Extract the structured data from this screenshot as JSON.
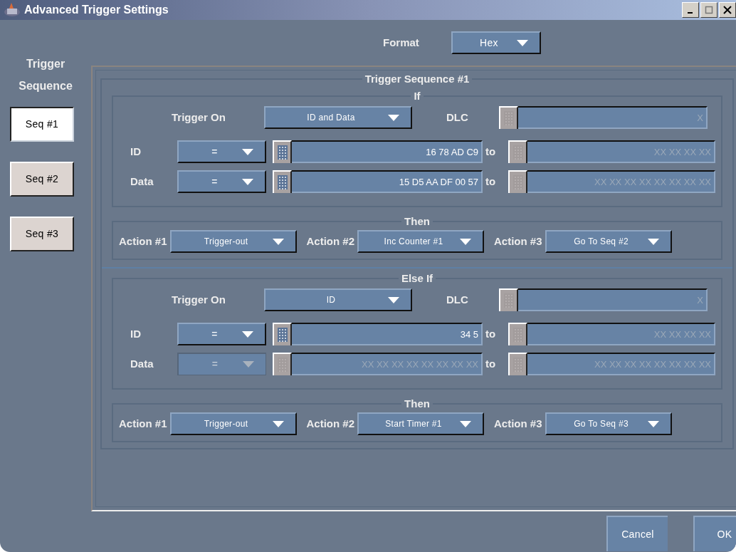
{
  "window": {
    "title": "Advanced Trigger Settings"
  },
  "format": {
    "label": "Format",
    "value": "Hex"
  },
  "sidebar": {
    "title": "Trigger Sequence",
    "items": [
      {
        "label": "Seq #1",
        "selected": true
      },
      {
        "label": "Seq #2",
        "selected": false
      },
      {
        "label": "Seq #3",
        "selected": false
      }
    ]
  },
  "panel": {
    "title": "Trigger Sequence #1",
    "blocks": [
      {
        "condition": {
          "title": "If",
          "trigger_on_label": "Trigger On",
          "trigger_on": "ID and Data",
          "dlc_label": "DLC",
          "dlc_placeholder": "X",
          "rows": [
            {
              "label": "ID",
              "operator": "=",
              "disabled": false,
              "from_value": "16 78 AD C9",
              "from_placeholder": "",
              "to_label": "to",
              "to_placeholder": "XX XX XX XX"
            },
            {
              "label": "Data",
              "operator": "=",
              "disabled": false,
              "from_value": "15 D5 AA DF 00 57",
              "from_placeholder": "",
              "to_label": "to",
              "to_placeholder": "XX XX XX XX XX XX XX XX"
            }
          ]
        },
        "then": {
          "title": "Then",
          "actions": [
            {
              "label": "Action #1",
              "value": "Trigger-out"
            },
            {
              "label": "Action #2",
              "value": "Inc Counter #1"
            },
            {
              "label": "Action #3",
              "value": "Go To Seq #2"
            }
          ]
        }
      },
      {
        "condition": {
          "title": "Else If",
          "trigger_on_label": "Trigger On",
          "trigger_on": "ID",
          "dlc_label": "DLC",
          "dlc_placeholder": "X",
          "rows": [
            {
              "label": "ID",
              "operator": "=",
              "disabled": false,
              "from_value": "34 5",
              "from_placeholder": "",
              "to_label": "to",
              "to_placeholder": "XX XX XX XX"
            },
            {
              "label": "Data",
              "operator": "=",
              "disabled": true,
              "from_value": "",
              "from_placeholder": "XX XX XX XX XX XX XX XX",
              "to_label": "to",
              "to_placeholder": "XX XX XX XX XX XX XX XX"
            }
          ]
        },
        "then": {
          "title": "Then",
          "actions": [
            {
              "label": "Action #1",
              "value": "Trigger-out"
            },
            {
              "label": "Action #2",
              "value": "Start Timer #1"
            },
            {
              "label": "Action #3",
              "value": "Go To Seq #3"
            }
          ]
        }
      }
    ]
  },
  "buttons": [
    {
      "label": "Cancel"
    },
    {
      "label": "OK"
    }
  ]
}
